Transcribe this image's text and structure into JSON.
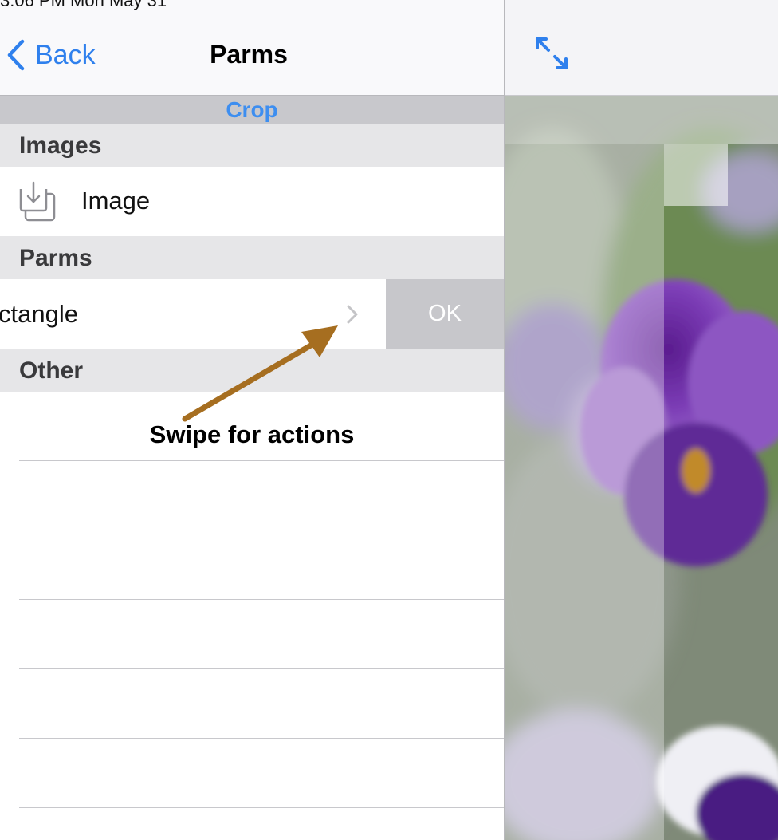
{
  "status_bar": {
    "text": "3:06 PM   Mon May 31"
  },
  "nav": {
    "back_label": "Back",
    "title": "Parms"
  },
  "tool": {
    "name": "Crop"
  },
  "sections": {
    "images": {
      "header": "Images",
      "row_label": "Image"
    },
    "parms": {
      "header": "Parms",
      "row_label": "ctangle",
      "swipe_action": "OK"
    },
    "other": {
      "header": "Other"
    }
  },
  "annotation": {
    "text": "Swipe for actions",
    "arrow_color": "#a66e20"
  },
  "colors": {
    "accent": "#2f80ed",
    "crop_title": "#3d8ef0"
  },
  "icons": [
    "chevron-left-icon",
    "import-image-icon",
    "chevron-right-icon",
    "expand-icon"
  ]
}
